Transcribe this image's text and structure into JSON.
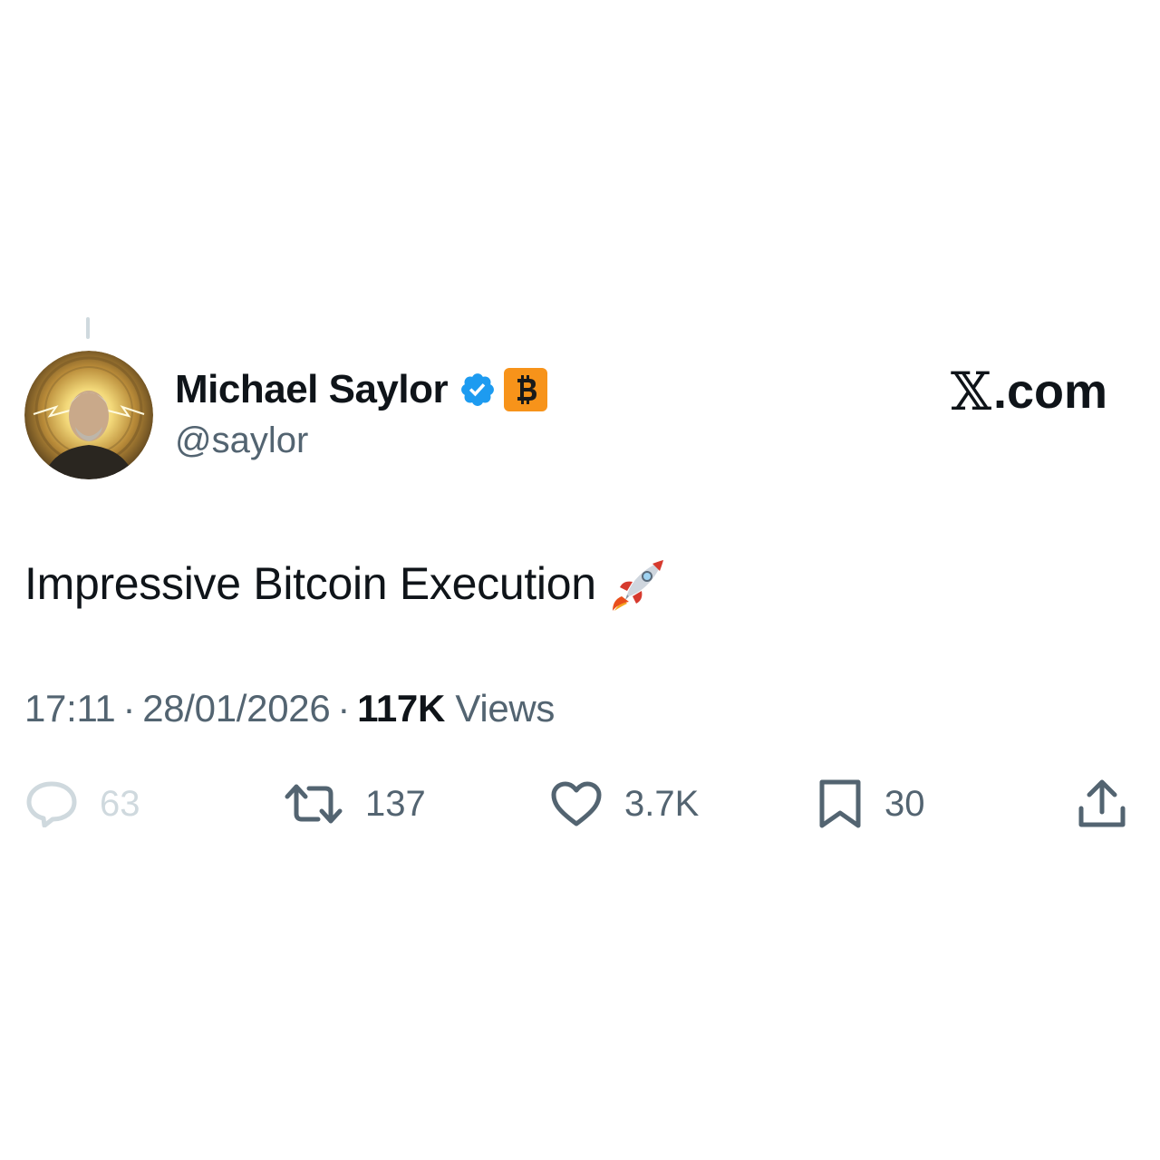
{
  "author": {
    "display_name": "Michael Saylor",
    "handle": "@saylor",
    "verified": true,
    "badge_icon": "bitcoin-icon",
    "badge_color": "#f7931a"
  },
  "brand": {
    "label": ".com",
    "logo": "x-logo"
  },
  "tweet": {
    "text": "Impressive Bitcoin Execution",
    "emoji": "rocket-emoji"
  },
  "meta": {
    "time": "17:11",
    "separator": "·",
    "date": "28/01/2026",
    "views_count": "117K",
    "views_label": "Views"
  },
  "actions": {
    "reply": {
      "icon": "reply-icon",
      "count": "63"
    },
    "repost": {
      "icon": "repost-icon",
      "count": "137"
    },
    "like": {
      "icon": "heart-icon",
      "count": "3.7K"
    },
    "bookmark": {
      "icon": "bookmark-icon",
      "count": "30"
    },
    "share": {
      "icon": "share-icon"
    }
  },
  "colors": {
    "text_primary": "#0f1419",
    "text_secondary": "#536471",
    "verified_blue": "#1d9bf0"
  }
}
